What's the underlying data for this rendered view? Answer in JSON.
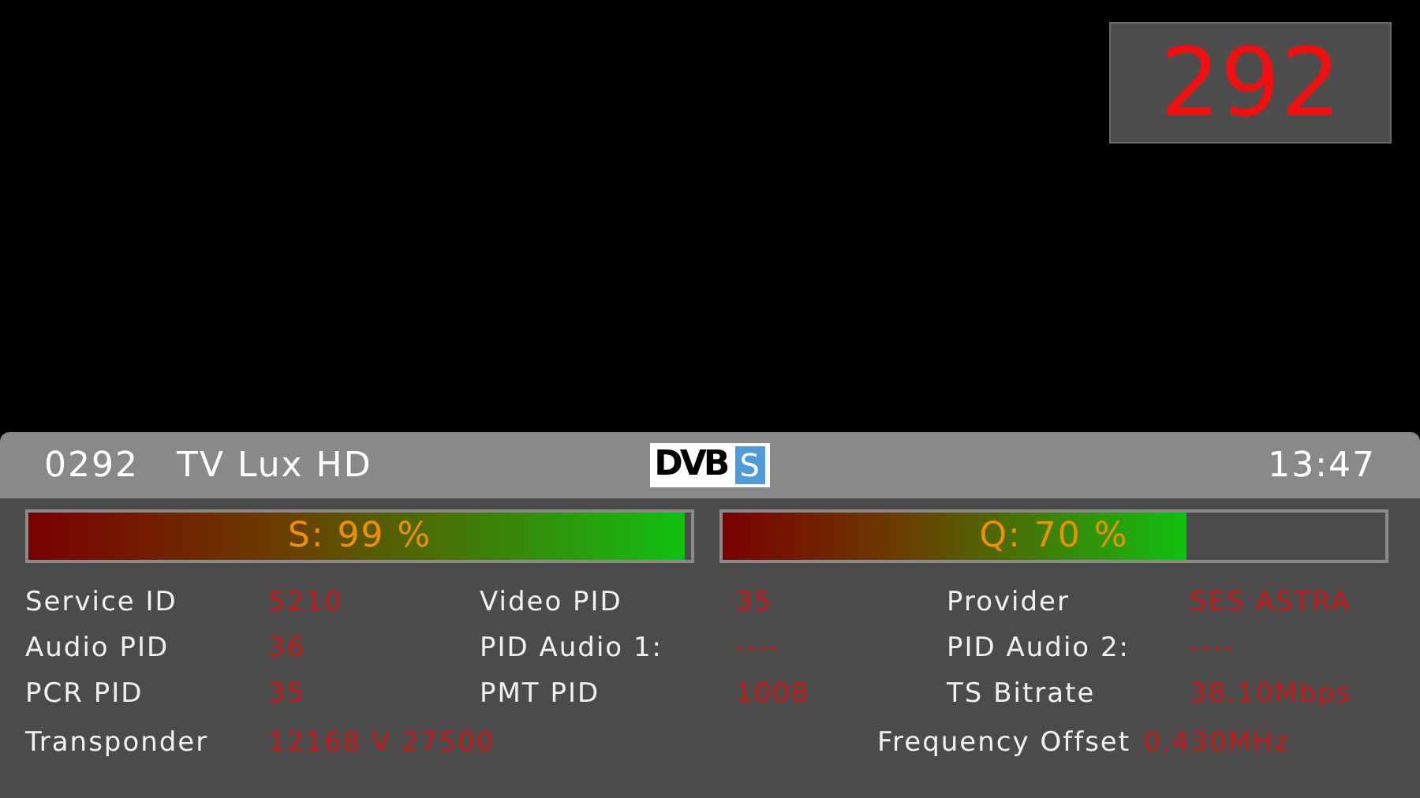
{
  "channel_number_badge": "292",
  "info_bar": {
    "channel_number": "0292",
    "channel_name": "TV Lux HD",
    "logo": {
      "text": "DVB",
      "suffix": "S"
    },
    "time": "13:47"
  },
  "meters": [
    {
      "label": "S: 99 %",
      "level": 0.99
    },
    {
      "label": "Q: 70 %",
      "level": 0.7
    }
  ],
  "details": [
    {
      "label": "Service ID",
      "value": "5210"
    },
    {
      "label": "Video PID",
      "value": "35"
    },
    {
      "label": "Provider",
      "value": "SES ASTRA"
    },
    {
      "label": "Audio PID",
      "value": "36"
    },
    {
      "label": "PID Audio 1:",
      "value": "----"
    },
    {
      "label": "PID Audio 2:",
      "value": "----"
    },
    {
      "label": "PCR PID",
      "value": "35"
    },
    {
      "label": "PMT PID",
      "value": "1008"
    },
    {
      "label": "TS Bitrate",
      "value": "38.10Mbps"
    }
  ],
  "transponder": {
    "label": "Transponder",
    "value": "12168 V 27500"
  },
  "frequency_offset": {
    "label": "Frequency Offset",
    "value": "0.430MHz"
  }
}
